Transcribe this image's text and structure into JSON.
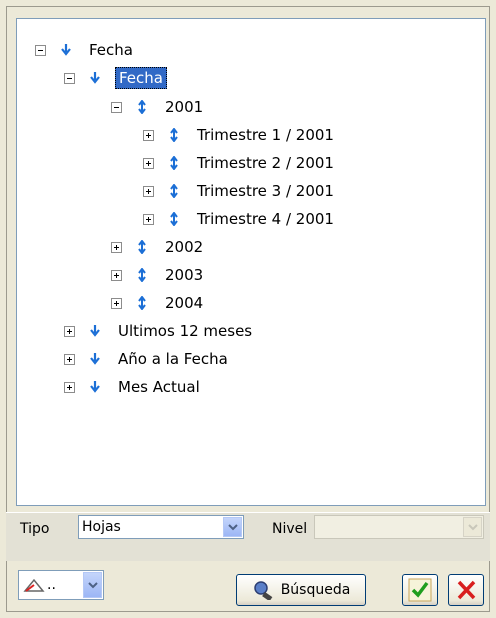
{
  "tree": {
    "nodes": [
      {
        "label": "Fecha",
        "toggle": "minus",
        "icon": "arrow-down"
      },
      {
        "label": "Fecha",
        "toggle": "minus",
        "icon": "arrow-down",
        "selected": true
      },
      {
        "label": "2001",
        "toggle": "minus",
        "icon": "arrow-updown"
      },
      {
        "label": "Trimestre 1 / 2001",
        "toggle": "plus",
        "icon": "arrow-updown"
      },
      {
        "label": "Trimestre 2 / 2001",
        "toggle": "plus",
        "icon": "arrow-updown"
      },
      {
        "label": "Trimestre 3 / 2001",
        "toggle": "plus",
        "icon": "arrow-updown"
      },
      {
        "label": "Trimestre 4 / 2001",
        "toggle": "plus",
        "icon": "arrow-updown"
      },
      {
        "label": "2002",
        "toggle": "plus",
        "icon": "arrow-updown"
      },
      {
        "label": "2003",
        "toggle": "plus",
        "icon": "arrow-updown"
      },
      {
        "label": "2004",
        "toggle": "plus",
        "icon": "arrow-updown"
      },
      {
        "label": "Ultimos 12 meses",
        "toggle": "plus",
        "icon": "arrow-down"
      },
      {
        "label": "Año a la Fecha",
        "toggle": "plus",
        "icon": "arrow-down"
      },
      {
        "label": "Mes Actual",
        "toggle": "plus",
        "icon": "arrow-down"
      }
    ]
  },
  "filters": {
    "tipo_label": "Tipo",
    "tipo_value": "Hojas",
    "nivel_label": "Nivel",
    "nivel_value": ""
  },
  "toolbar": {
    "tool_select_value": "..",
    "search_label": "Búsqueda"
  },
  "colors": {
    "accent": "#3169c6",
    "ok_green": "#1f9e1f",
    "cancel_red": "#d81e1e",
    "arrow_blue": "#1c6fd6"
  }
}
